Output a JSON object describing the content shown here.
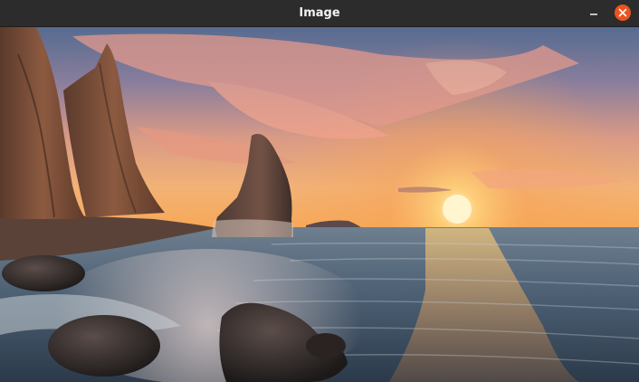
{
  "window": {
    "title": "Image"
  },
  "titlebar_buttons": {
    "minimize_icon": "minimize-icon",
    "close_icon": "close-icon",
    "close_color": "#e95420"
  },
  "image": {
    "subject": "sunset-seascape-photo"
  },
  "colors": {
    "titlebar": "#2c2c2c",
    "sun": "#fff2c0",
    "sky_top": "#5b6b8c",
    "horizon": "#f3a25a"
  }
}
